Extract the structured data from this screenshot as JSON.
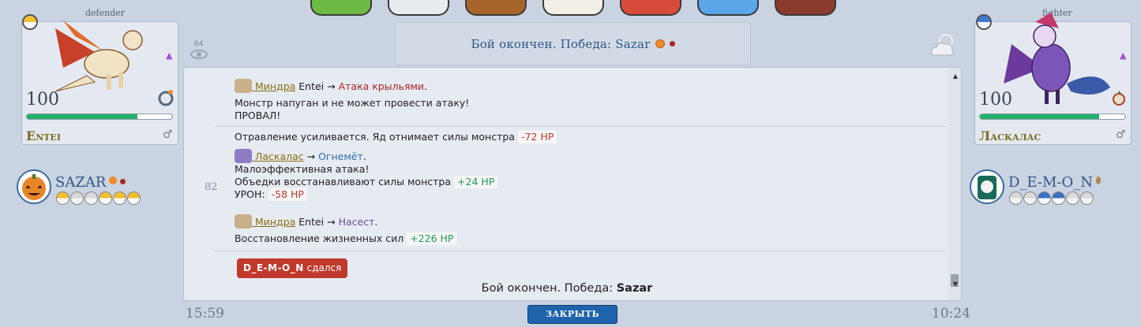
{
  "top_icons": [
    "cactus-icon",
    "pokeball-icon",
    "backpack-icon",
    "mail-icon",
    "badge-case-icon",
    "globe-icon",
    "wallet-icon"
  ],
  "header": {
    "title": "Бой окончен. Победа: Sazar"
  },
  "viewers": {
    "count": "64"
  },
  "left_monster": {
    "role": "defender",
    "level": "100",
    "name": "Entei",
    "hp_fraction": 0.76,
    "gender": "♂",
    "up_arrow": "▲"
  },
  "right_monster": {
    "role": "fighter",
    "level": "100",
    "name": "Ласкалас",
    "hp_fraction": 0.82,
    "gender": "♂",
    "up_arrow": "▲"
  },
  "left_player": {
    "name": "SAZAR",
    "team": [
      "gold",
      "grey",
      "grey",
      "gold",
      "gold",
      "gold"
    ]
  },
  "right_player": {
    "name": "D_E-M-O_N",
    "team": [
      "grey",
      "grey",
      "blue",
      "blue",
      "grey",
      "grey"
    ]
  },
  "log": {
    "t1": {
      "l1_trainer": " Миндра",
      "l1_mon": " Entei → ",
      "l1_attack": "Атака крыльями",
      "l1_end": ".",
      "l2": "Монстр напуган и не может провести атаку!",
      "l3": "ПРОВАЛ!"
    },
    "t2": {
      "number": "82",
      "l1": "Отравление усиливается. Яд отнимает силы монстра",
      "l1_hp": "-72 HP",
      "l2_trainer": " Ласкалас",
      "l2_arrow": " → ",
      "l2_attack": "Огнемёт",
      "l2_end": ".",
      "l3": "Малоэффективная атака!",
      "l4": "Объедки восстанавливают силы монстра",
      "l4_hp": "+24 HP",
      "l5": "УРОН:",
      "l5_hp": "-58 HP",
      "l6_trainer": " Миндра",
      "l6_mon": " Entei → ",
      "l6_attack": "Насест",
      "l6_end": ".",
      "l7": "Восстановление жизненных сил",
      "l7_hp": "+226 HP"
    },
    "surrender_name": "D_E-M-O_N",
    "surrender_text": " сдался",
    "final_prefix": "Бой окончен. Победа: ",
    "final_winner": "Sazar"
  },
  "footer": {
    "time_left": "15:59",
    "time_right": "10:24",
    "close_label": "ЗАКРЫТЬ"
  },
  "colors": {
    "accent": "#1f63ad",
    "hp_green": "#23b06a",
    "surrender_red": "#c0392b",
    "title_blue": "#2f5686"
  }
}
